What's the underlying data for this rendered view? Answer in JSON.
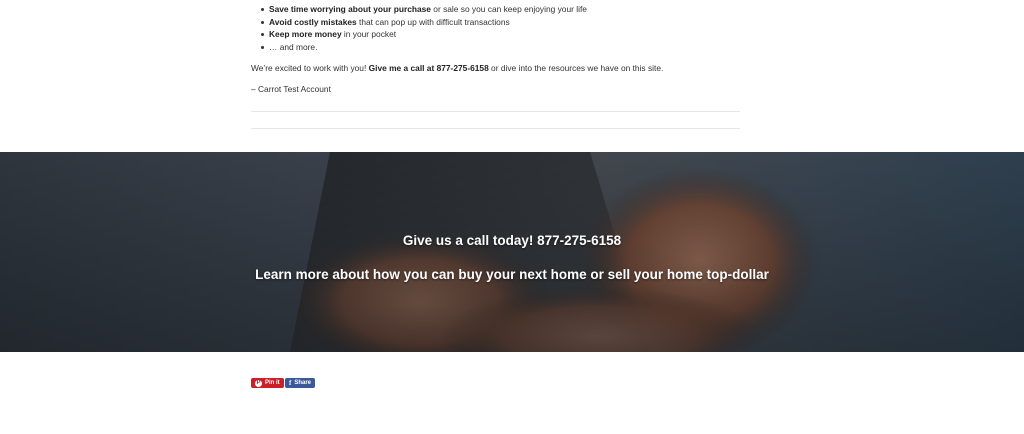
{
  "benefits": [
    {
      "bold": "Save time worrying about your purchase",
      "rest": " or sale so you can keep enjoying your life"
    },
    {
      "bold": "Avoid costly mistakes",
      "rest": " that can pop up with difficult transactions"
    },
    {
      "bold": "Keep more money",
      "rest": " in your pocket"
    },
    {
      "bold": "",
      "rest": "… and more."
    }
  ],
  "paragraph": {
    "before": "We’re excited to work with you! ",
    "bold": "Give me a call at 877-275-6158",
    "after": " or dive into the resources we have on this site."
  },
  "signature": "– Carrot Test Account",
  "banner": {
    "line1": "Give us a call today! 877-275-6158",
    "line2": "Learn more about how you can buy your next home or sell your home top-dollar"
  },
  "share": {
    "pin_label": "Pin it",
    "pin_icon": "P",
    "fb_label": "Share",
    "fb_icon": "f"
  },
  "colors": {
    "pinterest": "#cb2027",
    "facebook": "#3b5998"
  }
}
